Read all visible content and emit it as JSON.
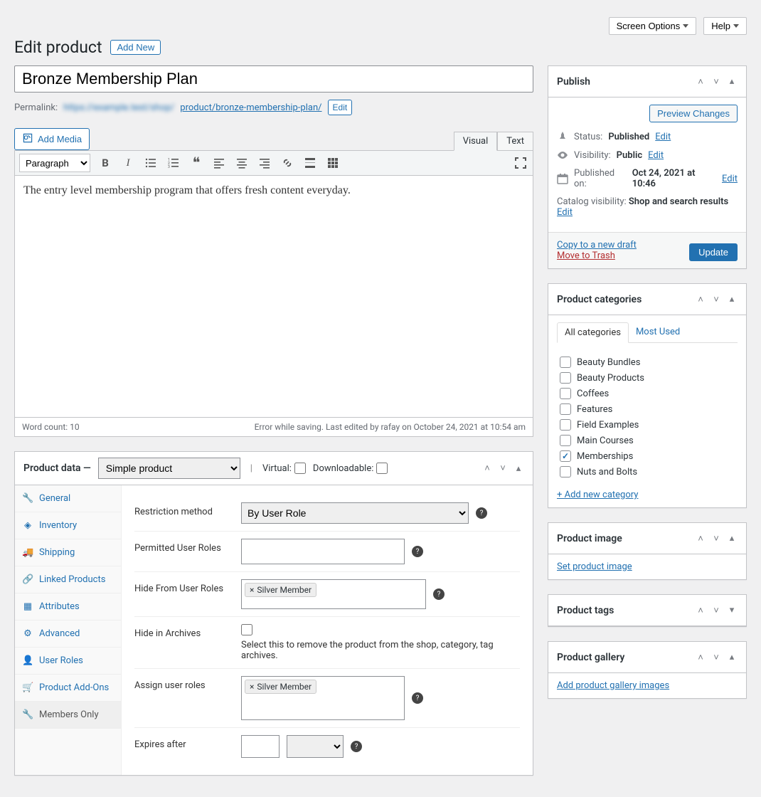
{
  "top": {
    "screen_options": "Screen Options",
    "help": "Help"
  },
  "heading": {
    "title": "Edit product",
    "add_new": "Add New"
  },
  "product": {
    "title": "Bronze Membership Plan",
    "permalink_label": "Permalink:",
    "permalink_base_blurred": "https://example.test/shop/",
    "permalink_slug": "product/bronze-membership-plan/",
    "permalink_edit": "Edit"
  },
  "editor": {
    "add_media": "Add Media",
    "tab_visual": "Visual",
    "tab_text": "Text",
    "format_select": "Paragraph",
    "content": "The entry level membership program that offers fresh content everyday.",
    "word_count": "Word count: 10",
    "status_line": "Error while saving. Last edited by rafay on October 24, 2021 at 10:54 am"
  },
  "product_data": {
    "heading": "Product data —",
    "type_select": "Simple product",
    "virtual_label": "Virtual:",
    "downloadable_label": "Downloadable:",
    "tabs": [
      {
        "icon": "🔧",
        "label": "General"
      },
      {
        "icon": "◈",
        "label": "Inventory"
      },
      {
        "icon": "🚚",
        "label": "Shipping"
      },
      {
        "icon": "🔗",
        "label": "Linked Products"
      },
      {
        "icon": "▦",
        "label": "Attributes"
      },
      {
        "icon": "⚙",
        "label": "Advanced"
      },
      {
        "icon": "👤",
        "label": "User Roles"
      },
      {
        "icon": "🛒",
        "label": "Product Add-Ons"
      },
      {
        "icon": "🔧",
        "label": "Members Only"
      }
    ],
    "active_tab_index": 8,
    "fields": {
      "restriction_method": {
        "label": "Restriction method",
        "value": "By User Role"
      },
      "permitted_roles": {
        "label": "Permitted User Roles"
      },
      "hide_roles": {
        "label": "Hide From User Roles",
        "tags": [
          "Silver Member"
        ]
      },
      "hide_archives": {
        "label": "Hide in Archives",
        "hint": "Select this to remove the product from the shop, category, tag archives."
      },
      "assign_roles": {
        "label": "Assign user roles",
        "tags": [
          "Silver Member"
        ]
      },
      "expires_after": {
        "label": "Expires after"
      }
    }
  },
  "publish": {
    "title": "Publish",
    "preview_btn": "Preview Changes",
    "status_label": "Status:",
    "status_value": "Published",
    "visibility_label": "Visibility:",
    "visibility_value": "Public",
    "published_label": "Published on:",
    "published_value": "Oct 24, 2021 at 10:46",
    "catalog_label": "Catalog visibility:",
    "catalog_value": "Shop and search results",
    "edit": "Edit",
    "copy_draft": "Copy to a new draft",
    "move_trash": "Move to Trash",
    "update_btn": "Update"
  },
  "categories": {
    "title": "Product categories",
    "tab_all": "All categories",
    "tab_most": "Most Used",
    "items": [
      {
        "label": "Beauty Bundles",
        "checked": false
      },
      {
        "label": "Beauty Products",
        "checked": false
      },
      {
        "label": "Coffees",
        "checked": false
      },
      {
        "label": "Features",
        "checked": false
      },
      {
        "label": "Field Examples",
        "checked": false
      },
      {
        "label": "Main Courses",
        "checked": false
      },
      {
        "label": "Memberships",
        "checked": true
      },
      {
        "label": "Nuts and Bolts",
        "checked": false
      }
    ],
    "add_new": "+ Add new category"
  },
  "product_image": {
    "title": "Product image",
    "link": "Set product image"
  },
  "product_tags": {
    "title": "Product tags"
  },
  "product_gallery": {
    "title": "Product gallery",
    "link": "Add product gallery images"
  }
}
